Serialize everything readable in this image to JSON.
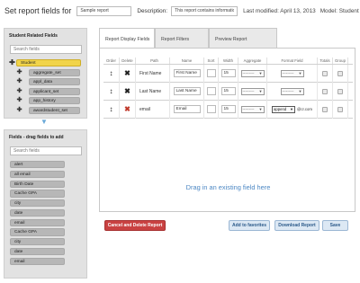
{
  "header": {
    "title": "Set report fields for",
    "report_name_value": "Sample report",
    "description_label": "Description:",
    "description_value": "This report contains information on curre...",
    "last_modified": "Last modified: April 13, 2013",
    "model": "Model: Student"
  },
  "student_panel": {
    "title": "Student Related Fields",
    "search_placeholder": "Search fields",
    "root": "Student",
    "children": [
      "aggregate_set",
      "appl_data",
      "applicant_set",
      "app_history",
      "awardstudent_set"
    ]
  },
  "fields_panel": {
    "title": "Fields - drag fields to add",
    "search_placeholder": "Search fields",
    "items": [
      "alert",
      "all email",
      "Birth Date",
      "Cache GPA",
      "city",
      "date",
      "email",
      "Cache GPA",
      "city",
      "date",
      "email"
    ]
  },
  "tabs": [
    "Report Display Fields",
    "Report Filters",
    "Preview Report"
  ],
  "columns": [
    "Order",
    "Delete",
    "Path",
    "Name",
    "Sort",
    "Width",
    "Aggregate",
    "Format Field",
    "Totals",
    "Group"
  ],
  "rows": [
    {
      "path": "",
      "name": "First Name",
      "width": "15",
      "aggregate": "---------",
      "format": "---------",
      "format_extra": "",
      "delete_color": "#222222"
    },
    {
      "path": "",
      "name": "Last Name",
      "width": "15",
      "aggregate": "---------",
      "format": "---------",
      "format_extra": "",
      "delete_color": "#222222"
    },
    {
      "path": "email",
      "name": "Email",
      "width": "15",
      "aggregate": "---------",
      "format": "append",
      "format_extra": "@cr.com",
      "delete_color": "#c0392b"
    }
  ],
  "row_paths": [
    "First Name",
    "Last Name",
    "email"
  ],
  "drop_hint": "Drag in an existing field here",
  "buttons": {
    "cancel_delete": "Cancel and Delete Report",
    "add_favorites": "Add to favorites",
    "download": "Download Report",
    "save": "Save"
  },
  "colors": {
    "accent_blue": "#4d88c4",
    "danger": "#c94141",
    "root_highlight": "#f1d44a"
  }
}
